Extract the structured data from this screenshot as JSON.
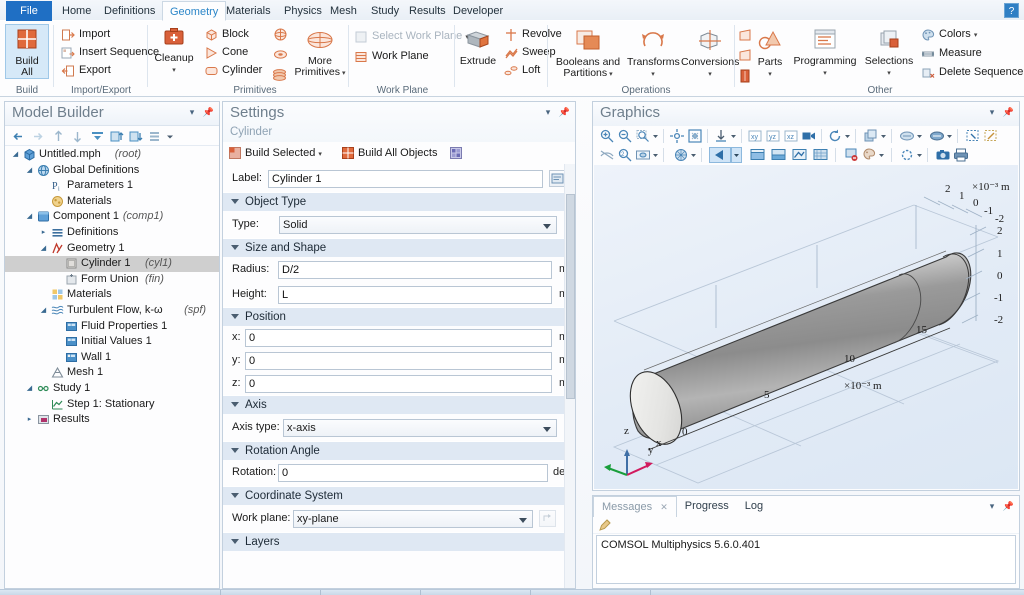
{
  "app": {
    "tabs": [
      {
        "label": "File",
        "active": false,
        "special": true
      },
      {
        "label": "Home",
        "active": false
      },
      {
        "label": "Definitions",
        "active": false
      },
      {
        "label": "Geometry",
        "active": true
      },
      {
        "label": "Materials",
        "active": false
      },
      {
        "label": "Physics",
        "active": false
      },
      {
        "label": "Mesh",
        "active": false
      },
      {
        "label": "Study",
        "active": false
      },
      {
        "label": "Results",
        "active": false
      },
      {
        "label": "Developer",
        "active": false
      }
    ],
    "help_label": "?",
    "accent": "#1f6fc4",
    "tab_active_color": "#2c86c8",
    "primitive_icon_color": "#d97a52"
  },
  "ribbon": {
    "groups": [
      {
        "name": "Build",
        "label": "Build"
      },
      {
        "name": "Import/Export",
        "label": "Import/Export"
      },
      {
        "name": "Cleanup",
        "label": ""
      },
      {
        "name": "Primitives",
        "label": "Primitives"
      },
      {
        "name": "Work Plane",
        "label": "Work Plane"
      },
      {
        "name": "Operations",
        "label": "Operations"
      },
      {
        "name": "Other",
        "label": "Other"
      }
    ],
    "build_all": "Build\nAll",
    "build_all_line1": "Build",
    "build_all_line2": "All",
    "import": "Import",
    "insert_sequence": "Insert Sequence",
    "export": "Export",
    "cleanup": "Cleanup",
    "block": "Block",
    "cone": "Cone",
    "cylinder": "Cylinder",
    "more_primitives_line1": "More",
    "more_primitives_line2": "Primitives",
    "select_work_plane": "Select Work Plane",
    "work_plane": "Work Plane",
    "extrude": "Extrude",
    "revolve": "Revolve",
    "sweep": "Sweep",
    "loft": "Loft",
    "booleans_line1": "Booleans and",
    "booleans_line2": "Partitions",
    "transforms": "Transforms",
    "conversions": "Conversions",
    "parts": "Parts",
    "programming": "Programming",
    "selections": "Selections",
    "colors": "Colors",
    "measure": "Measure",
    "delete_sequence": "Delete Sequence"
  },
  "model_builder": {
    "title": "Model Builder",
    "toolbar_icons": [
      "back-arrow-icon",
      "forward-arrow-icon",
      "move-up-icon",
      "move-down-icon",
      "collapse-all-icon",
      "expand-node-icon",
      "collapse-node-icon",
      "node-list-icon",
      "chevron-down-icon"
    ],
    "tree": [
      {
        "depth": 0,
        "twisty": "open",
        "icon": "mph-root-icon",
        "label": "Untitled.mph",
        "tag": "(root)"
      },
      {
        "depth": 1,
        "twisty": "open",
        "icon": "globe-icon",
        "label": "Global Definitions",
        "tag": ""
      },
      {
        "depth": 2,
        "twisty": "none",
        "icon": "parameters-icon",
        "label": "Parameters 1",
        "tag": ""
      },
      {
        "depth": 2,
        "twisty": "none",
        "icon": "materials-global-icon",
        "label": "Materials",
        "tag": ""
      },
      {
        "depth": 1,
        "twisty": "open",
        "icon": "component-icon",
        "label": "Component 1",
        "tag": "(comp1)"
      },
      {
        "depth": 2,
        "twisty": "closed",
        "icon": "definitions-icon",
        "label": "Definitions",
        "tag": ""
      },
      {
        "depth": 2,
        "twisty": "open",
        "icon": "geometry-icon",
        "label": "Geometry 1",
        "tag": ""
      },
      {
        "depth": 3,
        "twisty": "none",
        "icon": "cylinder-node-icon",
        "label": "Cylinder 1",
        "tag": "(cyl1)",
        "selected": true
      },
      {
        "depth": 3,
        "twisty": "none",
        "icon": "form-union-icon",
        "label": "Form Union",
        "tag": "(fin)"
      },
      {
        "depth": 2,
        "twisty": "none",
        "icon": "materials-icon",
        "label": "Materials",
        "tag": ""
      },
      {
        "depth": 2,
        "twisty": "open",
        "icon": "turbulent-flow-icon",
        "label": "Turbulent Flow, k-ω",
        "tag": "(spf)"
      },
      {
        "depth": 3,
        "twisty": "none",
        "icon": "fluid-properties-icon",
        "label": "Fluid Properties 1",
        "tag": ""
      },
      {
        "depth": 3,
        "twisty": "none",
        "icon": "initial-values-icon",
        "label": "Initial Values 1",
        "tag": ""
      },
      {
        "depth": 3,
        "twisty": "none",
        "icon": "wall-icon",
        "label": "Wall 1",
        "tag": ""
      },
      {
        "depth": 2,
        "twisty": "none",
        "icon": "mesh-icon",
        "label": "Mesh 1",
        "tag": ""
      },
      {
        "depth": 1,
        "twisty": "open",
        "icon": "study-icon",
        "label": "Study 1",
        "tag": ""
      },
      {
        "depth": 2,
        "twisty": "none",
        "icon": "stationary-step-icon",
        "label": "Step 1: Stationary",
        "tag": ""
      },
      {
        "depth": 1,
        "twisty": "closed",
        "icon": "results-icon",
        "label": "Results",
        "tag": ""
      }
    ]
  },
  "settings": {
    "title": "Settings",
    "subtitle": "Cylinder",
    "toolbar": {
      "build_selected": "Build Selected",
      "build_all_objects": "Build All Objects",
      "plot_icon": "plot-icon"
    },
    "label_field": {
      "label": "Label:",
      "value": "Cylinder 1"
    },
    "sections": [
      {
        "name": "object-type",
        "title": "Object Type",
        "rows": [
          {
            "kind": "select",
            "label": "Type:",
            "value": "Solid",
            "name": "type-select"
          }
        ]
      },
      {
        "name": "size-and-shape",
        "title": "Size and Shape",
        "rows": [
          {
            "kind": "input",
            "label": "Radius:",
            "value": "D/2",
            "unit": "m",
            "name": "radius-input"
          },
          {
            "kind": "input",
            "label": "Height:",
            "value": "L",
            "unit": "m",
            "name": "height-input"
          }
        ]
      },
      {
        "name": "position",
        "title": "Position",
        "rows": [
          {
            "kind": "input",
            "label": "x:",
            "value": "0",
            "unit": "m",
            "name": "position-x-input"
          },
          {
            "kind": "input",
            "label": "y:",
            "value": "0",
            "unit": "m",
            "name": "position-y-input"
          },
          {
            "kind": "input",
            "label": "z:",
            "value": "0",
            "unit": "m",
            "name": "position-z-input"
          }
        ]
      },
      {
        "name": "axis",
        "title": "Axis",
        "rows": [
          {
            "kind": "select",
            "label": "Axis type:",
            "value": "x-axis",
            "name": "axis-type-select"
          }
        ]
      },
      {
        "name": "rotation-angle",
        "title": "Rotation Angle",
        "rows": [
          {
            "kind": "input",
            "label": "Rotation:",
            "value": "0",
            "unit": "deg",
            "name": "rotation-input"
          }
        ]
      },
      {
        "name": "coordinate-system",
        "title": "Coordinate System",
        "rows": [
          {
            "kind": "select",
            "label": "Work plane:",
            "value": "xy-plane",
            "unit": "",
            "name": "work-plane-select",
            "extra_button": true
          }
        ]
      },
      {
        "name": "layers",
        "title": "Layers",
        "rows": []
      }
    ]
  },
  "graphics": {
    "title": "Graphics",
    "toolbar_row1": [
      "zoom-in-icon",
      "zoom-out-icon",
      "zoom-box-icon",
      "chevron-down-icon",
      "zoom-extents-icon",
      "zoom-to-selection-icon",
      "orthographic-icon",
      "chevron-down-icon",
      "view-xy-icon",
      "view-yz-icon",
      "view-xz-icon",
      "camera-view-icon",
      "rotate-icon",
      "chevron-down-icon",
      "scene-light-icon",
      "chevron-down-icon",
      "transparency-icon",
      "chevron-down-icon",
      "wireframe-icon",
      "chevron-down-icon",
      "select-box-icon",
      "clear-selection-icon"
    ],
    "toolbar_row2": [
      "hide-icon",
      "zoom-selection-icon",
      "view-hidden-icon",
      "chevron-down-icon",
      "mesh-render-icon",
      "chevron-down-icon",
      "select-arrow-icon",
      "chevron-down-icon",
      "select-domains-icon",
      "select-boundaries-icon",
      "select-edges-icon",
      "select-points-icon",
      "delete-selection-icon",
      "color-legend-icon",
      "chevron-down-icon",
      "reset-view-icon",
      "chevron-down-icon",
      "snapshot-icon",
      "print-icon"
    ],
    "scene": {
      "x_axis": {
        "ticks": [
          "0",
          "5",
          "10",
          "15"
        ],
        "exponent_label": "×10⁻³ m"
      },
      "y_axis": {
        "ticks": [
          "2",
          "1",
          "0",
          "-1",
          "-2"
        ],
        "exponent_label": "×10⁻³ m"
      },
      "z_axis": {
        "ticks": [
          "2",
          "1",
          "0",
          "-1",
          "-2"
        ]
      },
      "triad": {
        "x": "x",
        "y": "y",
        "z": "z"
      },
      "object": "cylinder"
    }
  },
  "messages": {
    "tabs": [
      {
        "label": "Messages",
        "active": true,
        "closable": true
      },
      {
        "label": "Progress",
        "active": false
      },
      {
        "label": "Log",
        "active": false
      }
    ],
    "toolbar_icon": "clear-messages-icon",
    "lines": [
      "COMSOL Multiphysics 5.6.0.401"
    ]
  }
}
